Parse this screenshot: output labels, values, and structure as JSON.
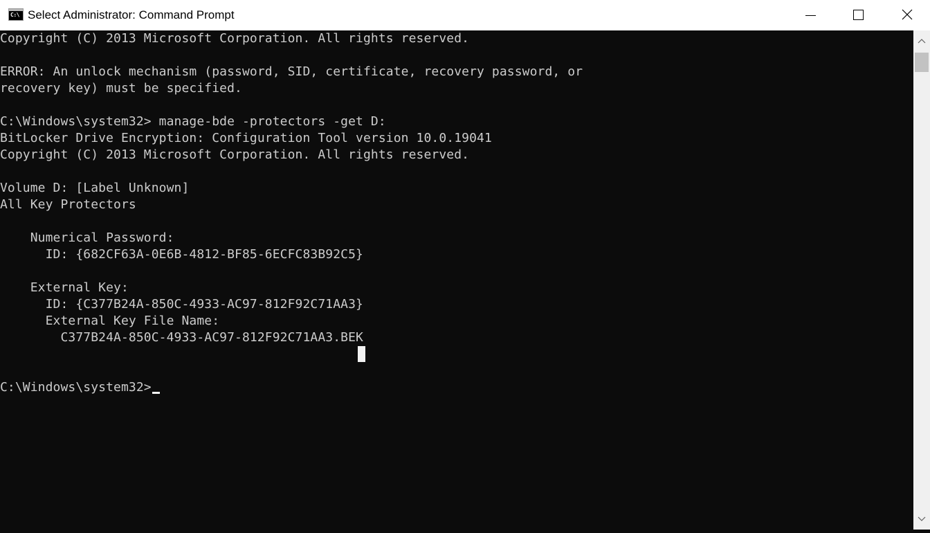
{
  "window": {
    "title": "Select Administrator: Command Prompt",
    "app_icon_text": "C:\\"
  },
  "controls": {
    "minimize": "minimize-icon",
    "maximize": "maximize-icon",
    "close": "close-icon"
  },
  "console": {
    "lines": [
      "Copyright (C) 2013 Microsoft Corporation. All rights reserved.",
      "",
      "ERROR: An unlock mechanism (password, SID, certificate, recovery password, or",
      "recovery key) must be specified.",
      "",
      "C:\\Windows\\system32> manage-bde -protectors -get D:",
      "BitLocker Drive Encryption: Configuration Tool version 10.0.19041",
      "Copyright (C) 2013 Microsoft Corporation. All rights reserved.",
      "",
      "Volume D: [Label Unknown]",
      "All Key Protectors",
      "",
      "    Numerical Password:",
      "      ID: {682CF63A-0E6B-4812-BF85-6ECFC83B92C5}",
      "",
      "    External Key:",
      "      ID: {C377B24A-850C-4933-AC97-812F92C71AA3}",
      "      External Key File Name:",
      "        C377B24A-850C-4933-AC97-812F92C71AA3.BEK",
      "",
      "",
      "C:\\Windows\\system32>"
    ]
  },
  "colors": {
    "console_bg": "#0c0c0c",
    "console_fg": "#cccccc",
    "titlebar_bg": "#ffffff"
  }
}
